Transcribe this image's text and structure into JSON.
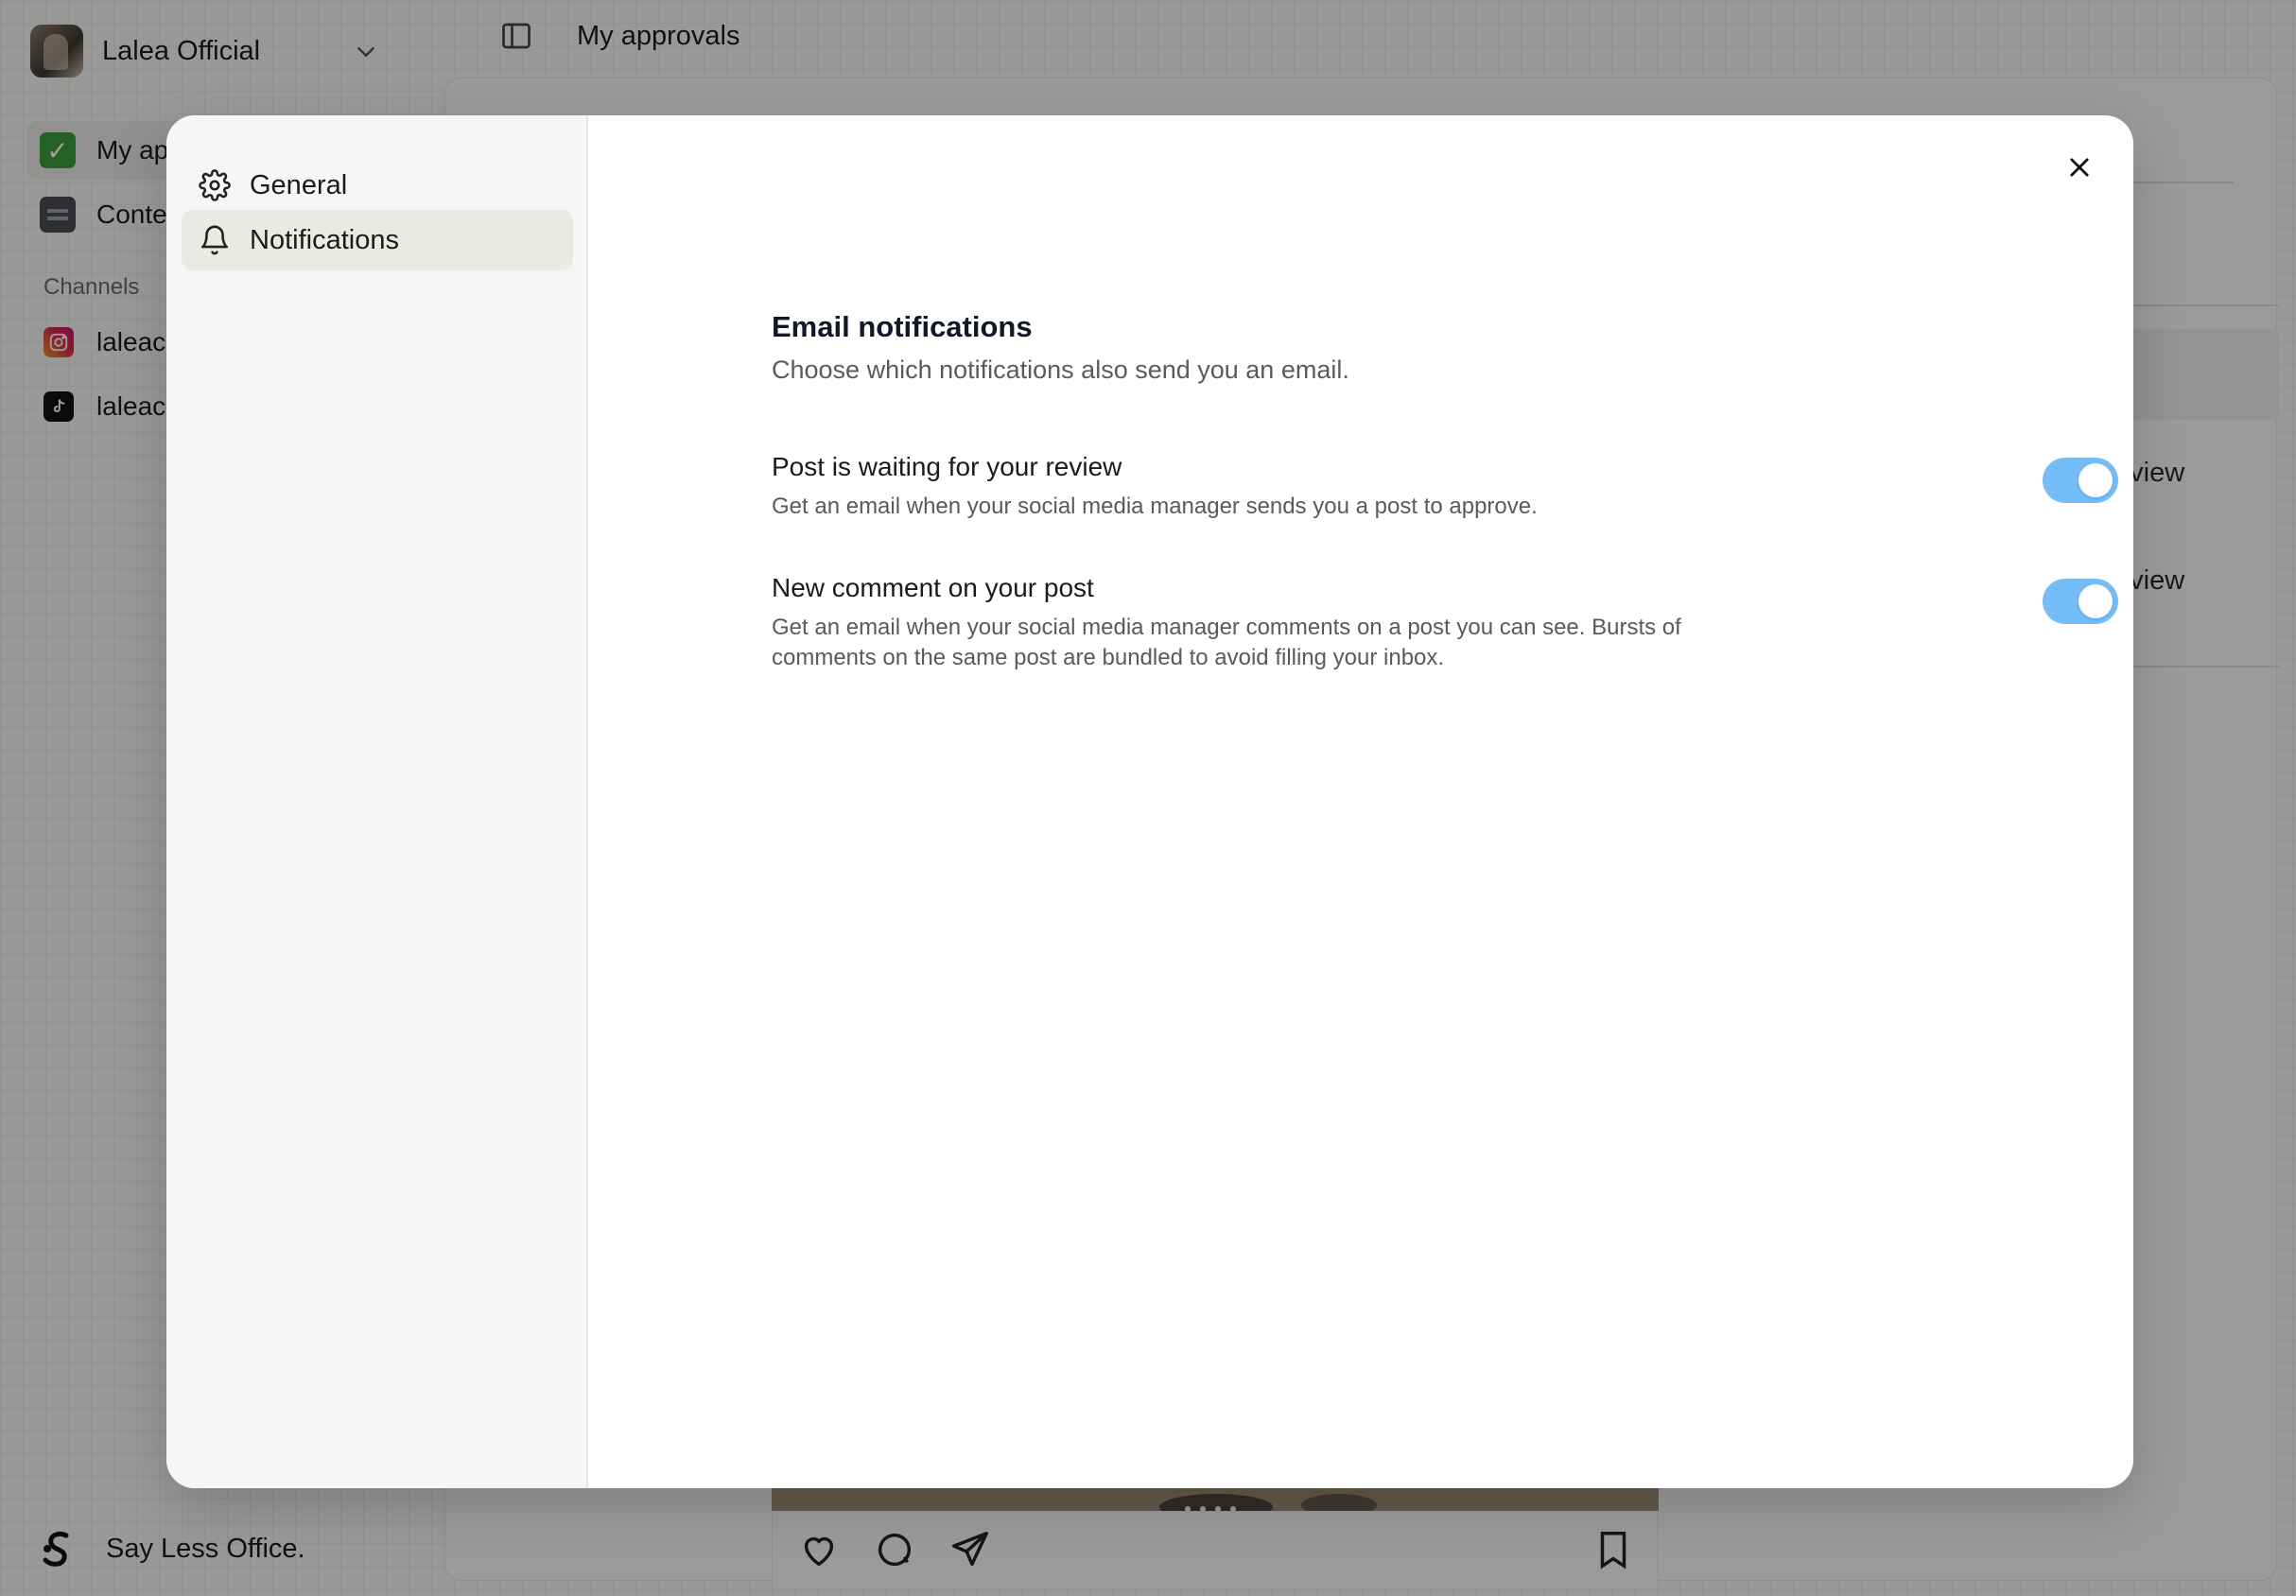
{
  "workspace": {
    "name": "Lalea Official"
  },
  "sidebar": {
    "items": [
      {
        "label": "My ap",
        "icon": "check-emoji-icon"
      },
      {
        "label": "Conte",
        "icon": "file-cabinet-emoji-icon"
      }
    ],
    "section_label": "Channels",
    "channels": [
      {
        "label": "laleac",
        "icon": "instagram-icon"
      },
      {
        "label": "laleac",
        "icon": "tiktok-icon"
      }
    ],
    "brand": "Say Less Office."
  },
  "header": {
    "title": "My approvals"
  },
  "background_fragments": {
    "row1": "eview",
    "row2": "eview"
  },
  "modal": {
    "nav": [
      {
        "label": "General",
        "icon": "gear-icon"
      },
      {
        "label": "Notifications",
        "icon": "bell-icon"
      }
    ],
    "active_nav": "Notifications",
    "title": "Email notifications",
    "subtitle": "Choose which notifications also send you an email.",
    "settings": [
      {
        "title": "Post is waiting for your review",
        "description": "Get an email when your social media manager sends you a post to approve.",
        "enabled": true
      },
      {
        "title": "New comment on your post",
        "description": "Get an email when your social media manager comments on a post you can see. Bursts of comments on the same post are bundled to avoid filling your inbox.",
        "enabled": true
      }
    ]
  },
  "colors": {
    "toggle_on": "#74bdf8",
    "overlay": "rgba(0,0,0,0.38)"
  }
}
